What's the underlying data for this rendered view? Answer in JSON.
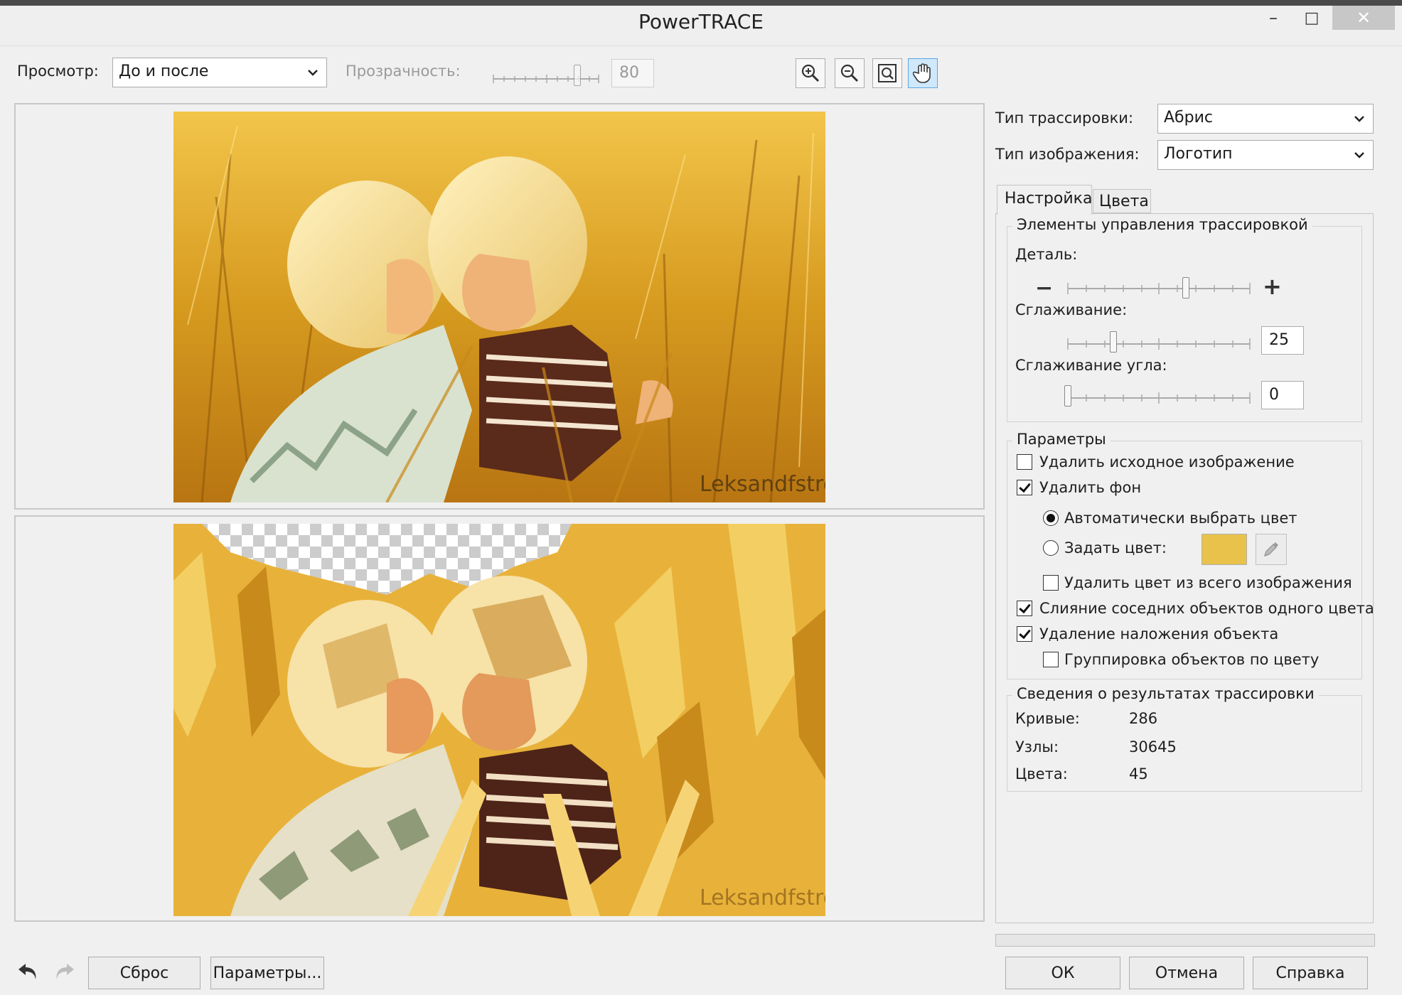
{
  "window": {
    "title": "PowerTRACE",
    "minimize": "–",
    "maximize": "□",
    "close": "✕"
  },
  "toolbar": {
    "view_label": "Просмотр:",
    "view_value": "До и после",
    "transparency_label": "Прозрачность:",
    "transparency_value": "80",
    "transparency_level": 0.8,
    "zoom_in_icon": "zoom-in-icon",
    "zoom_out_icon": "zoom-out-icon",
    "fit_icon": "zoom-fit-icon",
    "pan_icon": "hand-pan-icon"
  },
  "preview": {
    "before_caption": "Leksandfstreak",
    "after_caption": "Leksandfstreak"
  },
  "settings": {
    "trace_type_label": "Тип трассировки:",
    "trace_type_value": "Абрис",
    "image_type_label": "Тип изображения:",
    "image_type_value": "Логотип",
    "tabs": [
      {
        "label": "Настройка",
        "active": true
      },
      {
        "label": "Цвета",
        "active": false
      }
    ],
    "controls_group": {
      "title": "Элементы управления трассировкой",
      "detail_label": "Деталь:",
      "detail_minus": "−",
      "detail_plus": "+",
      "detail_level": 0.65,
      "smoothing_label": "Сглаживание:",
      "smoothing_value": "25",
      "smoothing_level": 0.25,
      "corner_label": "Сглаживание угла:",
      "corner_value": "0",
      "corner_level": 0
    },
    "params_group": {
      "title": "Параметры",
      "delete_original": {
        "label": "Удалить исходное изображение",
        "checked": false
      },
      "remove_bg": {
        "label": "Удалить фон",
        "checked": true
      },
      "auto_color": {
        "label": "Автоматически выбрать цвет",
        "selected": true
      },
      "set_color": {
        "label": "Задать цвет:",
        "selected": false,
        "swatch": "#e8c24a"
      },
      "remove_color_all": {
        "label": "Удалить цвет из всего изображения",
        "checked": false
      },
      "merge_adjacent": {
        "label": "Слияние соседних объектов одного цвета",
        "checked": true
      },
      "remove_overlap": {
        "label": "Удаление наложения объекта",
        "checked": true
      },
      "group_by_color": {
        "label": "Группировка объектов по цвету",
        "checked": false
      }
    },
    "results_group": {
      "title": "Сведения о результатах трассировки",
      "curves_label": "Кривые:",
      "curves_value": "286",
      "nodes_label": "Узлы:",
      "nodes_value": "30645",
      "colors_label": "Цвета:",
      "colors_value": "45"
    }
  },
  "footer": {
    "undo_icon": "undo-icon",
    "redo_icon": "redo-icon",
    "reset_label": "Сброс",
    "options_label": "Параметры...",
    "ok_label": "ОК",
    "cancel_label": "Отмена",
    "help_label": "Справка"
  }
}
